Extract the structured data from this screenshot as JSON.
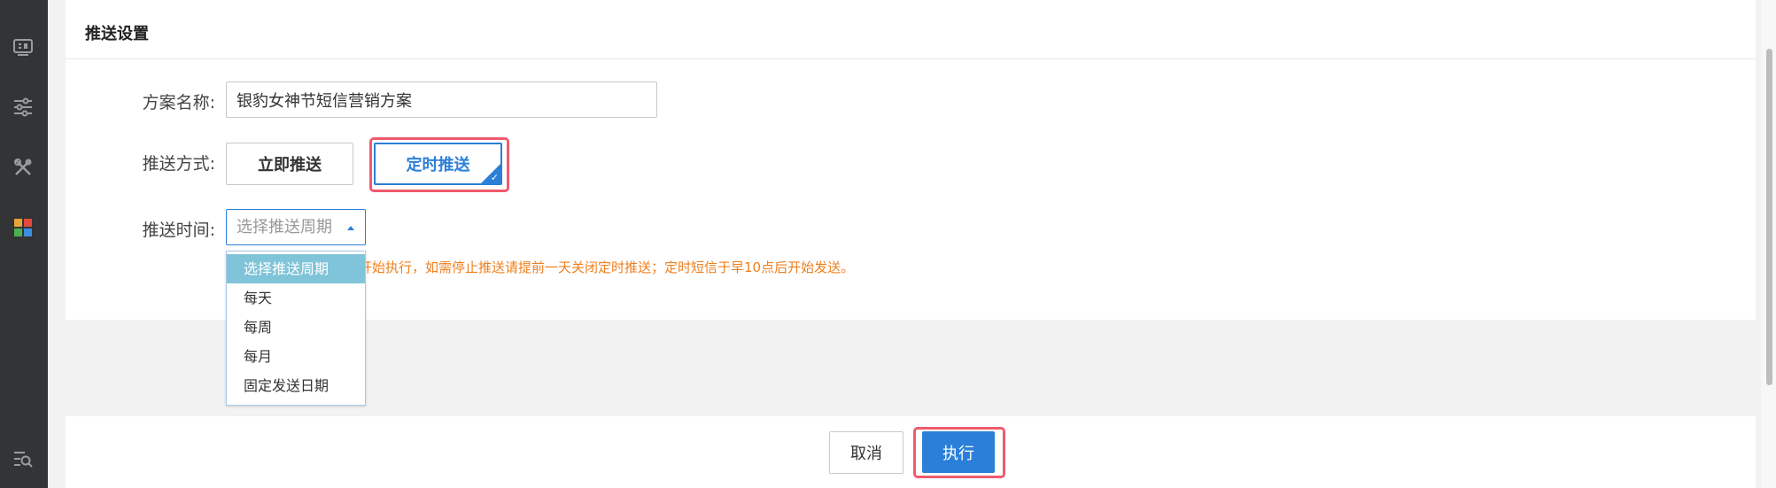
{
  "sidebar": {
    "icons": [
      "ticket-icon",
      "sliders-icon",
      "tools-icon",
      "apps-grid-icon",
      "search-list-icon"
    ]
  },
  "panel": {
    "title": "推送设置"
  },
  "form": {
    "name_label": "方案名称:",
    "name_value": "银豹女神节短信营销方案",
    "method_label": "推送方式:",
    "method_options": [
      "立即推送",
      "定时推送"
    ],
    "method_selected": "定时推送",
    "time_label": "推送时间:",
    "time_placeholder": "选择推送周期",
    "hint_visible": "开始执行，如需停止推送请提前一天关闭定时推送；定时短信于早10点后开始发送。"
  },
  "dropdown": {
    "options": [
      "选择推送周期",
      "每天",
      "每周",
      "每月",
      "固定发送日期"
    ],
    "highlighted": "选择推送周期"
  },
  "footer": {
    "cancel_label": "取消",
    "execute_label": "执行"
  },
  "colors": {
    "accent": "#2b7fd9",
    "highlight_border": "#f05a6e",
    "hint_text": "#f07f1d",
    "sidebar_bg": "#323436",
    "dropdown_active": "#7fc4d8"
  }
}
